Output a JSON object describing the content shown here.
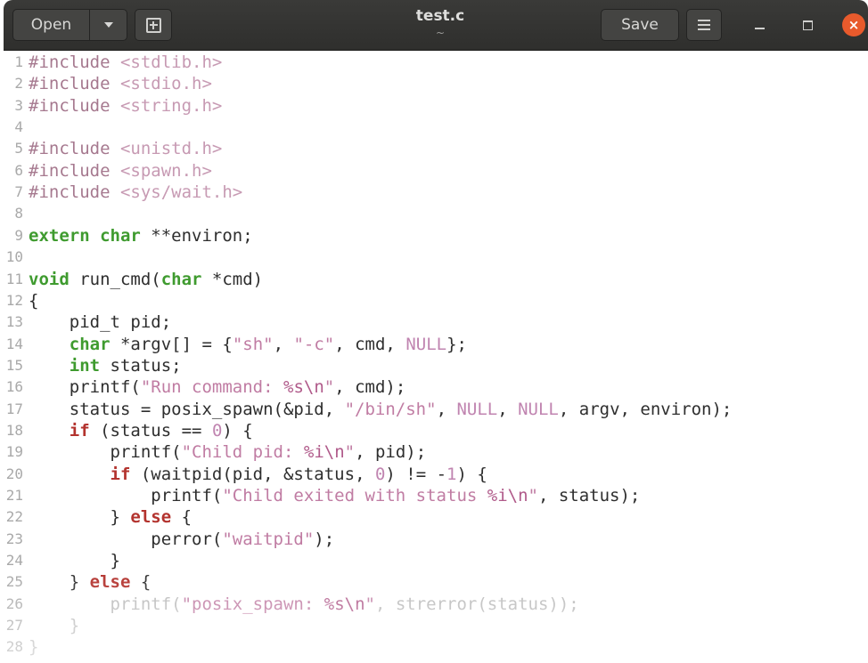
{
  "window": {
    "title": "test.c",
    "subtitle": "~"
  },
  "headerbar": {
    "open_label": "Open",
    "save_label": "Save"
  },
  "editor": {
    "lines": [
      {
        "n": "1",
        "tokens": [
          [
            "pp",
            "#include "
          ],
          [
            "hdr",
            "<stdlib.h>"
          ]
        ]
      },
      {
        "n": "2",
        "tokens": [
          [
            "pp",
            "#include "
          ],
          [
            "hdr",
            "<stdio.h>"
          ]
        ]
      },
      {
        "n": "3",
        "tokens": [
          [
            "pp",
            "#include "
          ],
          [
            "hdr",
            "<string.h>"
          ]
        ]
      },
      {
        "n": "4",
        "tokens": []
      },
      {
        "n": "5",
        "tokens": [
          [
            "pp",
            "#include "
          ],
          [
            "hdr",
            "<unistd.h>"
          ]
        ]
      },
      {
        "n": "6",
        "tokens": [
          [
            "pp",
            "#include "
          ],
          [
            "hdr",
            "<spawn.h>"
          ]
        ]
      },
      {
        "n": "7",
        "tokens": [
          [
            "pp",
            "#include "
          ],
          [
            "hdr",
            "<sys/wait.h>"
          ]
        ]
      },
      {
        "n": "8",
        "tokens": []
      },
      {
        "n": "9",
        "tokens": [
          [
            "kw",
            "extern"
          ],
          [
            "id",
            " "
          ],
          [
            "ty",
            "char"
          ],
          [
            "id",
            " **environ;"
          ]
        ]
      },
      {
        "n": "10",
        "tokens": []
      },
      {
        "n": "11",
        "tokens": [
          [
            "ty",
            "void"
          ],
          [
            "id",
            " run_cmd("
          ],
          [
            "ty",
            "char"
          ],
          [
            "id",
            " *cmd)"
          ]
        ]
      },
      {
        "n": "12",
        "tokens": [
          [
            "id",
            "{"
          ]
        ]
      },
      {
        "n": "13",
        "tokens": [
          [
            "id",
            "    pid_t pid;"
          ]
        ]
      },
      {
        "n": "14",
        "tokens": [
          [
            "id",
            "    "
          ],
          [
            "ty",
            "char"
          ],
          [
            "id",
            " *argv[] = {"
          ],
          [
            "st",
            "\"sh\""
          ],
          [
            "id",
            ", "
          ],
          [
            "st",
            "\"-c\""
          ],
          [
            "id",
            ", cmd, "
          ],
          [
            "nm",
            "NULL"
          ],
          [
            "id",
            "};"
          ]
        ]
      },
      {
        "n": "15",
        "tokens": [
          [
            "id",
            "    "
          ],
          [
            "ty",
            "int"
          ],
          [
            "id",
            " status;"
          ]
        ]
      },
      {
        "n": "16",
        "tokens": [
          [
            "id",
            "    printf("
          ],
          [
            "st",
            "\"Run command: "
          ],
          [
            "esc",
            "%s\\n"
          ],
          [
            "st",
            "\""
          ],
          [
            "id",
            ", cmd);"
          ]
        ]
      },
      {
        "n": "17",
        "tokens": [
          [
            "id",
            "    status = posix_spawn(&pid, "
          ],
          [
            "st",
            "\"/bin/sh\""
          ],
          [
            "id",
            ", "
          ],
          [
            "nm",
            "NULL"
          ],
          [
            "id",
            ", "
          ],
          [
            "nm",
            "NULL"
          ],
          [
            "id",
            ", argv, environ);"
          ]
        ]
      },
      {
        "n": "18",
        "tokens": [
          [
            "id",
            "    "
          ],
          [
            "ctl",
            "if"
          ],
          [
            "id",
            " (status == "
          ],
          [
            "nm",
            "0"
          ],
          [
            "id",
            ") {"
          ]
        ]
      },
      {
        "n": "19",
        "tokens": [
          [
            "id",
            "        printf("
          ],
          [
            "st",
            "\"Child pid: "
          ],
          [
            "esc",
            "%i\\n"
          ],
          [
            "st",
            "\""
          ],
          [
            "id",
            ", pid);"
          ]
        ]
      },
      {
        "n": "20",
        "tokens": [
          [
            "id",
            "        "
          ],
          [
            "ctl",
            "if"
          ],
          [
            "id",
            " (waitpid(pid, &status, "
          ],
          [
            "nm",
            "0"
          ],
          [
            "id",
            ") != -"
          ],
          [
            "nm",
            "1"
          ],
          [
            "id",
            ") {"
          ]
        ]
      },
      {
        "n": "21",
        "tokens": [
          [
            "id",
            "            printf("
          ],
          [
            "st",
            "\"Child exited with status "
          ],
          [
            "esc",
            "%i\\n"
          ],
          [
            "st",
            "\""
          ],
          [
            "id",
            ", status);"
          ]
        ]
      },
      {
        "n": "22",
        "tokens": [
          [
            "id",
            "        } "
          ],
          [
            "ctl",
            "else"
          ],
          [
            "id",
            " {"
          ]
        ]
      },
      {
        "n": "23",
        "tokens": [
          [
            "id",
            "            perror("
          ],
          [
            "st",
            "\"waitpid\""
          ],
          [
            "id",
            ");"
          ]
        ]
      },
      {
        "n": "24",
        "tokens": [
          [
            "id",
            "        }"
          ]
        ]
      },
      {
        "n": "25",
        "tokens": [
          [
            "id",
            "    } "
          ],
          [
            "ctl",
            "else"
          ],
          [
            "id",
            " {"
          ]
        ]
      },
      {
        "n": "26",
        "tokens": [
          [
            "id",
            "        printf("
          ],
          [
            "st",
            "\"posix_spawn: "
          ],
          [
            "esc",
            "%s\\n"
          ],
          [
            "st",
            "\""
          ],
          [
            "id",
            ", strerror(status));"
          ]
        ]
      },
      {
        "n": "27",
        "tokens": [
          [
            "id",
            "    }"
          ]
        ]
      },
      {
        "n": "28",
        "tokens": [
          [
            "id",
            "}"
          ]
        ]
      }
    ]
  }
}
